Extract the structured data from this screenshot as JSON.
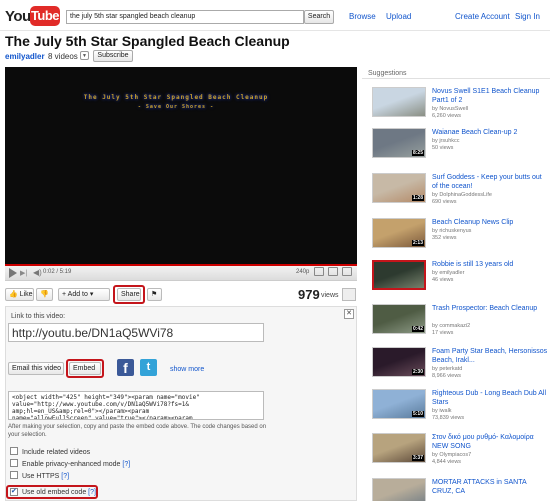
{
  "header": {
    "logo_you": "You",
    "logo_tube": "Tube",
    "search_query": "the july 5th star spangled beach cleanup",
    "search_button": "Search",
    "nav": [
      "Browse",
      "Upload"
    ],
    "account": [
      "Create Account",
      "Sign In"
    ]
  },
  "video": {
    "title": "The July 5th Star Spangled Beach Cleanup",
    "channel": "emilyadler",
    "video_count": "8 videos",
    "subscribe": "Subscribe",
    "frame_title": "The July 5th Star Spangled Beach Cleanup",
    "frame_subtitle": "- Save Our Shores -",
    "time": "0:02 / 5:19",
    "quality": "240p",
    "views": "979",
    "views_label": "views",
    "progress_fraction": 0.006
  },
  "actions": {
    "like": "Like",
    "add_to": "Add to",
    "share": "Share"
  },
  "share": {
    "link_label": "Link to this video:",
    "url": "http://youtu.be/DN1aQ5WVi78",
    "email_button": "Email this video",
    "embed_button": "Embed",
    "show_more": "show more",
    "embed_code": "<object width=\"425\" height=\"349\"><param name=\"movie\"\nvalue=\"http://www.youtube.com/v/DN1aQ5WVi78?fs=1&\namp;hl=en_US&amp;rel=0\"></param><param\nname=\"allowFullScreen\" value=\"true\"></param><param",
    "embed_note": "After making your selection, copy and paste the embed code above. The code changes based on your selection.",
    "options": [
      {
        "label": "Include related videos",
        "checked": false,
        "help": ""
      },
      {
        "label": "Enable privacy-enhanced mode",
        "checked": false,
        "help": "[?]"
      },
      {
        "label": "Use HTTPS",
        "checked": false,
        "help": "[?]"
      },
      {
        "label": "Use old embed code",
        "checked": true,
        "help": "[?]"
      }
    ]
  },
  "suggestions": {
    "heading": "Suggestions",
    "items": [
      {
        "title": "Novus Swell S1E1 Beach Cleanup Part1 of 2",
        "by": "by NovusSwell",
        "views": "6,260 views",
        "duration": "",
        "colors": [
          "#c9d6e2",
          "#8a8f84"
        ]
      },
      {
        "title": "Waianae Beach Clean-up 2",
        "by": "by jrsuhkcc",
        "views": "50 views",
        "duration": "8:25",
        "colors": [
          "#6e7884",
          "#97a09e"
        ]
      },
      {
        "title": "Surf Goddess - Keep your butts out of the ocean!",
        "by": "by DolphinaGoddessLife",
        "views": "690 views",
        "duration": "1:28",
        "colors": [
          "#c7b9a6",
          "#b48a68"
        ]
      },
      {
        "title": "Beach Cleanup News Clip",
        "by": "by richuskenyus",
        "views": "352 views",
        "duration": "2:13",
        "colors": [
          "#c4a16c",
          "#7c5a3c"
        ]
      },
      {
        "title": "Robbie is still 13 years old",
        "by": "by emilyadler",
        "views": "46 views",
        "duration": "",
        "colors": [
          "#2d3a2f",
          "#77826d"
        ]
      },
      {
        "title": "Trash Prospector: Beach Cleanup",
        "by": "by commakazi2",
        "views": "17 views",
        "duration": "0:42",
        "colors": [
          "#4f5c44",
          "#8d9a86"
        ]
      },
      {
        "title": "Foam Party Star Beach, Hersonissos Beach, Irakl...",
        "by": "by peterkatd",
        "views": "8,966 views",
        "duration": "2:30",
        "colors": [
          "#2a1a2a",
          "#6a4c5a"
        ]
      },
      {
        "title": "Righteous Dub - Long Beach Dub All Stars",
        "by": "by iwalk",
        "views": "73,839 views",
        "duration": "5:10",
        "colors": [
          "#8fb1d6",
          "#5a7b9c"
        ]
      },
      {
        "title": "Στον δικό μου ρυθμό- Καλομοίρα NEW SONG",
        "by": "by Olympiacos7",
        "views": "4,844 views",
        "duration": "3:37",
        "colors": [
          "#b7a37e",
          "#5d4a3a"
        ]
      },
      {
        "title": "MORTAR ATTACKS in SANTA CRUZ, CA",
        "by": "",
        "views": "",
        "duration": "",
        "colors": [
          "#b8ad9a",
          "#6f7b84"
        ]
      }
    ]
  },
  "accent": {
    "red": "#c4151b",
    "link": "#1155cc"
  }
}
